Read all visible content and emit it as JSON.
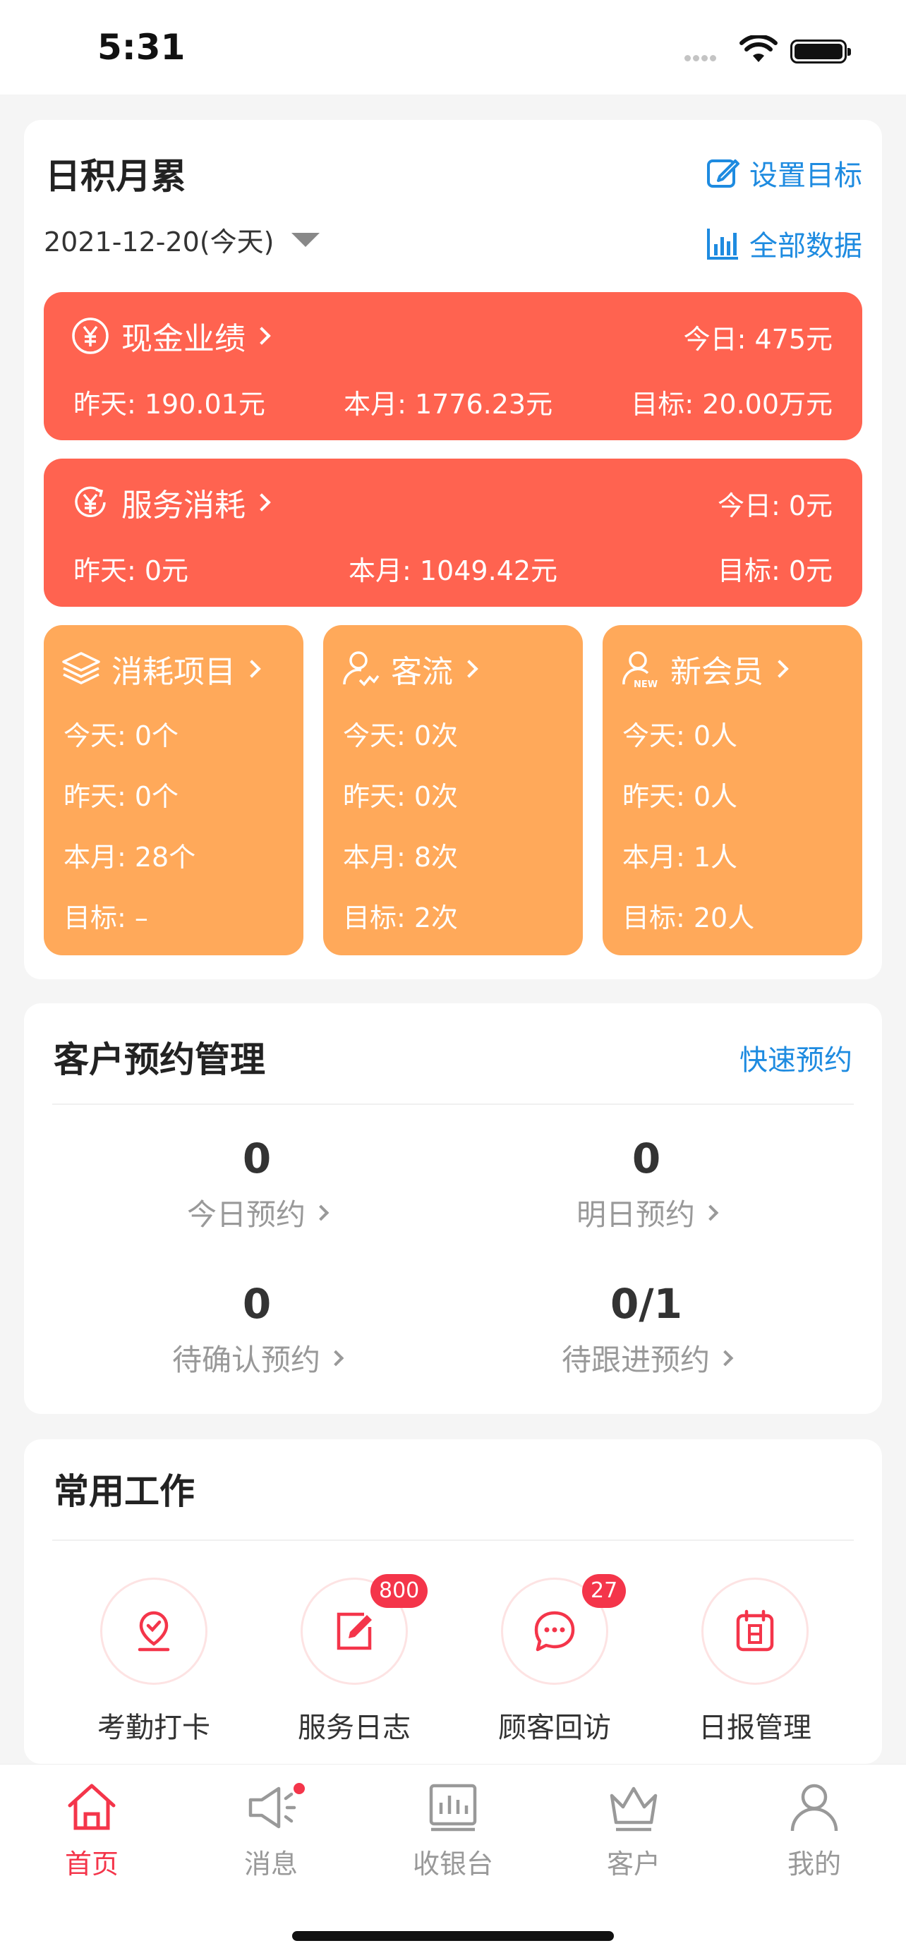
{
  "status": {
    "time": "5:31"
  },
  "summary": {
    "title": "日积月累",
    "set_goal": "设置目标",
    "all_data": "全部数据",
    "date": "2021-12-20(今天)",
    "cash": {
      "label": "现金业绩",
      "today": "今日: 475元",
      "yesterday": "昨天: 190.01元",
      "month": "本月: 1776.23元",
      "target": "目标: 20.00万元"
    },
    "service": {
      "label": "服务消耗",
      "today": "今日: 0元",
      "yesterday": "昨天: 0元",
      "month": "本月: 1049.42元",
      "target": "目标: 0元"
    },
    "boxes": [
      {
        "label": "消耗项目",
        "today": "今天: 0个",
        "yesterday": "昨天: 0个",
        "month": "本月: 28个",
        "target": "目标: –"
      },
      {
        "label": "客流",
        "today": "今天: 0次",
        "yesterday": "昨天: 0次",
        "month": "本月: 8次",
        "target": "目标: 2次"
      },
      {
        "label": "新会员",
        "today": "今天: 0人",
        "yesterday": "昨天: 0人",
        "month": "本月: 1人",
        "target": "目标: 20人"
      }
    ]
  },
  "appointments": {
    "title": "客户预约管理",
    "quick": "快速预约",
    "stats": [
      {
        "value": "0",
        "label": "今日预约"
      },
      {
        "value": "0",
        "label": "明日预约"
      },
      {
        "value": "0",
        "label": "待确认预约"
      },
      {
        "value": "0/1",
        "label": "待跟进预约"
      }
    ]
  },
  "work": {
    "title": "常用工作",
    "tools": [
      {
        "label": "考勤打卡",
        "icon": "checkin-icon"
      },
      {
        "label": "服务日志",
        "icon": "edit-icon",
        "badge": "800"
      },
      {
        "label": "顾客回访",
        "icon": "chat-icon",
        "badge": "27"
      },
      {
        "label": "日报管理",
        "icon": "calendar-icon"
      }
    ]
  },
  "tabs": [
    {
      "label": "首页",
      "icon": "home-icon",
      "active": true
    },
    {
      "label": "消息",
      "icon": "megaphone-icon"
    },
    {
      "label": "收银台",
      "icon": "cashier-icon"
    },
    {
      "label": "客户",
      "icon": "crown-icon"
    },
    {
      "label": "我的",
      "icon": "user-icon"
    }
  ],
  "colors": {
    "red": "#ff6350",
    "orange": "#ffa95a",
    "blue": "#1e8be0",
    "accent": "#f4354a"
  }
}
